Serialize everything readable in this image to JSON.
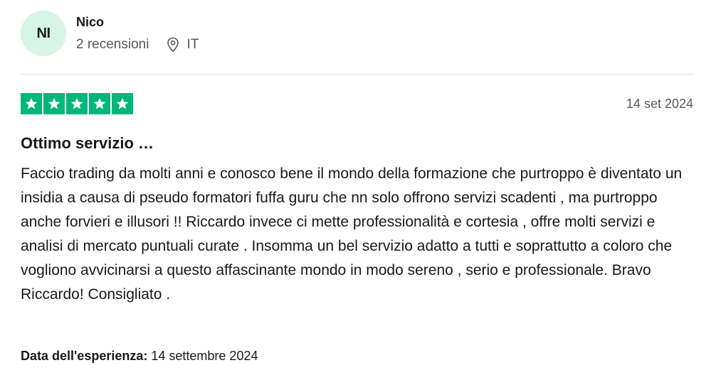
{
  "reviewer": {
    "initials": "NI",
    "name": "Nico",
    "review_count": "2 recensioni",
    "country": "IT",
    "avatar_color": "#d6f5e6"
  },
  "review": {
    "rating": 5,
    "max_rating": 5,
    "star_color": "#00b67a",
    "date": "14 set 2024",
    "title": "Ottimo servizio …",
    "body": "Faccio trading da molti anni e conosco bene il mondo della formazione che purtroppo è diventato un insidia a causa di pseudo formatori fuffa guru che nn solo offrono servizi scadenti , ma purtroppo anche forvieri e illusori !! Riccardo invece ci mette professionalità e cortesia , offre molti servizi e analisi di mercato puntuali curate . Insomma un bel servizio adatto a tutti e soprattutto a coloro che vogliono avvicinarsi a questo affascinante mondo in modo sereno , serio e professionale. Bravo Riccardo! Consigliato .",
    "experience_label": "Data dell'esperienza:",
    "experience_date": "14 settembre 2024"
  },
  "icons": {
    "location": "location-pin-icon",
    "star": "star-icon"
  }
}
